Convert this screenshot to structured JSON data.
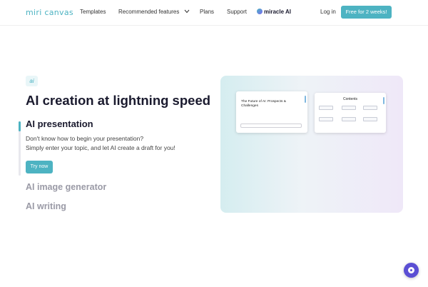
{
  "header": {
    "logo": "miri canvas",
    "nav": [
      "Templates",
      "Recommended features",
      "Plans",
      "Support"
    ],
    "miracle_ai": "miracle AI",
    "login": "Log in",
    "cta": "Free for 2 weeks!"
  },
  "hero": {
    "badge": "ai",
    "title": "AI creation at lightning speed",
    "active_feature": "AI presentation",
    "description_line1": "Don't know how to begin your presentation?",
    "description_line2": "Simply enter your topic, and let AI create a draft for you!",
    "try_button": "Try now",
    "other_features": [
      "AI image generator",
      "AI writing"
    ],
    "progress": 0.18
  },
  "preview": {
    "slide1_title": "The Future of AI: Prospects & Challenges",
    "slide2_title": "Contents"
  },
  "icons": {
    "chevron": "chevron-down-icon",
    "chat": "chat-icon"
  },
  "colors": {
    "accent": "#4db3c2",
    "chat": "#5b4fd4"
  }
}
